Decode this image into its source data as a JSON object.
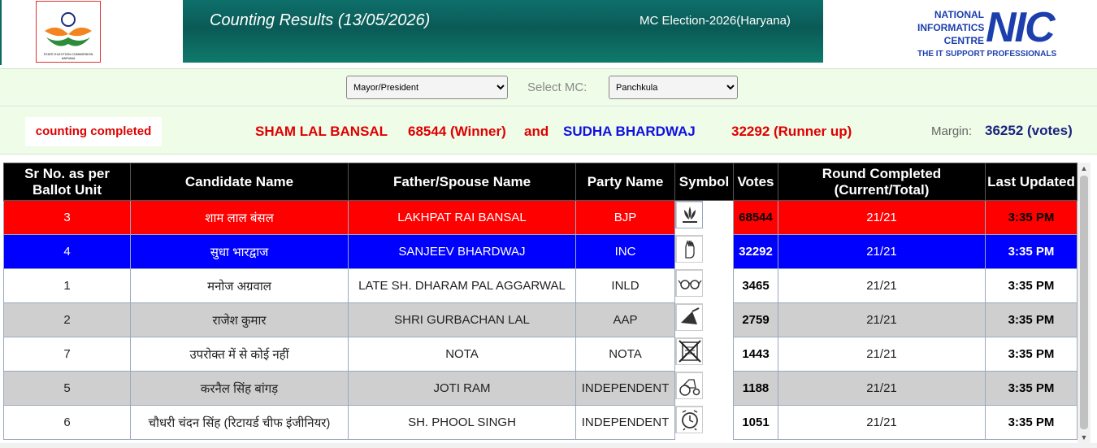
{
  "header": {
    "title": "Counting Results (13/05/2026)",
    "subtitle": "MC Election-2026(Haryana)",
    "sec_logo_text": "STATE ELECTION COMMISSION HARYANA",
    "nic": {
      "line1": "NATIONAL",
      "line2": "INFORMATICS",
      "line3": "CENTRE",
      "big": "NIC",
      "tagline": "THE IT SUPPORT PROFESSIONALS"
    }
  },
  "filters": {
    "post": {
      "selected": "Mayor/President"
    },
    "mc_label": "Select MC:",
    "mc": {
      "selected": "Panchkula"
    }
  },
  "summary": {
    "status": "counting completed",
    "winner_name": "SHAM LAL BANSAL",
    "winner_votes": "68544 (Winner)",
    "and": "and",
    "runner_name": "SUDHA BHARDWAJ",
    "runner_votes": "32292 (Runner up)",
    "margin_label": "Margin:",
    "margin_value": "36252 (votes)"
  },
  "table": {
    "headers": {
      "sr": "Sr No. as per Ballot Unit",
      "candidate": "Candidate Name",
      "father": "Father/Spouse Name",
      "party": "Party Name",
      "symbol": "Symbol",
      "votes": "Votes",
      "round": "Round Completed (Current/Total)",
      "updated": "Last Updated"
    },
    "rows": [
      {
        "sr": "3",
        "candidate": "शाम लाल बंसल",
        "father": "LAKHPAT RAI BANSAL",
        "party": "BJP",
        "symbol": "lotus-icon",
        "votes": "68544",
        "round": "21/21",
        "updated": "3:35 PM",
        "style": "r-red"
      },
      {
        "sr": "4",
        "candidate": "सुधा भारद्वाज",
        "father": "SANJEEV BHARDWAJ",
        "party": "INC",
        "symbol": "hand-icon",
        "votes": "32292",
        "round": "21/21",
        "updated": "3:35 PM",
        "style": "r-blue"
      },
      {
        "sr": "1",
        "candidate": "मनोज अग्रवाल",
        "father": "LATE SH. DHARAM PAL AGGARWAL",
        "party": "INLD",
        "symbol": "spectacles-icon",
        "votes": "3465",
        "round": "21/21",
        "updated": "3:35 PM",
        "style": "r-white"
      },
      {
        "sr": "2",
        "candidate": "राजेश कुमार",
        "father": "SHRI GURBACHAN LAL",
        "party": "AAP",
        "symbol": "broom-icon",
        "votes": "2759",
        "round": "21/21",
        "updated": "3:35 PM",
        "style": "r-grey"
      },
      {
        "sr": "7",
        "candidate": "उपरोक्त में से कोई नहीं",
        "father": "NOTA",
        "party": "NOTA",
        "symbol": "nota-icon",
        "votes": "1443",
        "round": "21/21",
        "updated": "3:35 PM",
        "style": "r-white"
      },
      {
        "sr": "5",
        "candidate": "करनैल सिंह बांगड़",
        "father": "JOTI RAM",
        "party": "INDEPENDENT",
        "symbol": "tractor-icon",
        "votes": "1188",
        "round": "21/21",
        "updated": "3:35 PM",
        "style": "r-grey"
      },
      {
        "sr": "6",
        "candidate": "चौधरी चंदन सिंह (रिटायर्ड चीफ इंजीनियर)",
        "father": "SH. PHOOL SINGH",
        "party": "INDEPENDENT",
        "symbol": "alarm-clock-icon",
        "votes": "1051",
        "round": "21/21",
        "updated": "3:35 PM",
        "style": "r-white"
      }
    ]
  }
}
